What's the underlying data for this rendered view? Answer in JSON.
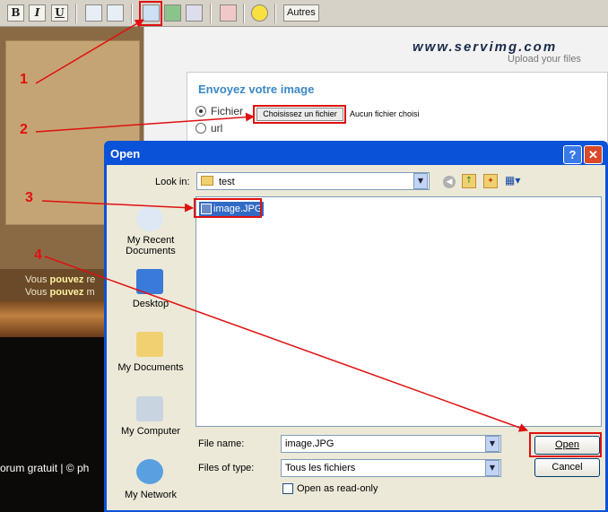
{
  "toolbar": {
    "bold_label": "B",
    "italic_label": "I",
    "underline_label": "U",
    "autres_label": "Autres"
  },
  "forum": {
    "line1_prefix": "Vous ",
    "line1_bold": "pouvez",
    "line1_suffix": " re",
    "line2_prefix": "Vous ",
    "line2_bold": "pouvez",
    "line2_suffix": " m",
    "footer": "orum gratuit | © ph"
  },
  "servimg": {
    "logo": "www.servimg.com",
    "tagline": "Upload your files",
    "title": "Envoyez votre image",
    "option_file": "Fichier",
    "option_url": "url",
    "choose_button": "Choisissez un fichier",
    "no_file": "Aucun fichier choisi"
  },
  "dialog": {
    "title": "Open",
    "help": "?",
    "close": "✕",
    "look_in_label": "Look in:",
    "look_in_value": "test",
    "places": [
      "My Recent Documents",
      "Desktop",
      "My Documents",
      "My Computer",
      "My Network"
    ],
    "selected_file": "image.JPG",
    "file_name_label": "File name:",
    "file_name_value": "image.JPG",
    "file_type_label": "Files of type:",
    "file_type_value": "Tous les fichiers",
    "readonly_label": "Open as read-only",
    "open_button": "Open",
    "cancel_button": "Cancel"
  },
  "annotations": {
    "steps": [
      "1",
      "2",
      "3",
      "4"
    ],
    "color": "#e01010"
  }
}
